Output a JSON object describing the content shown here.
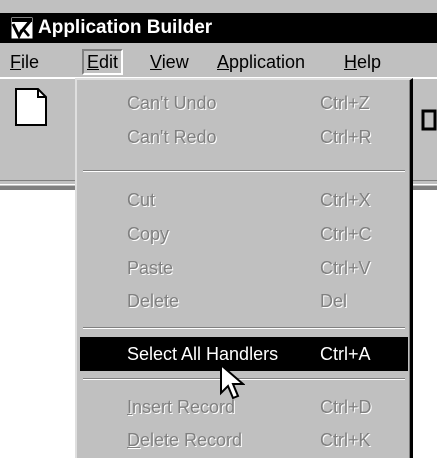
{
  "window": {
    "title": "Application Builder",
    "icon": "app-builder-icon"
  },
  "menubar": {
    "items": [
      {
        "label": "File",
        "accel": "F",
        "rest": "ile"
      },
      {
        "label": "Edit",
        "accel": "E",
        "rest": "dit"
      },
      {
        "label": "View",
        "accel": "V",
        "rest": "iew"
      },
      {
        "label": "Application",
        "accel": "A",
        "rest": "pplication"
      },
      {
        "label": "Help",
        "accel": "H",
        "rest": "elp"
      }
    ],
    "open_menu": "Edit"
  },
  "toolbar": {
    "new_icon": "new-document-icon"
  },
  "edit_menu": {
    "items": [
      {
        "label": "Can't Undo",
        "shortcut": "Ctrl+Z",
        "enabled": false
      },
      {
        "label": "Can't Redo",
        "shortcut": "Ctrl+R",
        "enabled": false
      },
      {
        "label": "Cut",
        "shortcut": "Ctrl+X",
        "enabled": false
      },
      {
        "label": "Copy",
        "shortcut": "Ctrl+C",
        "enabled": false
      },
      {
        "label": "Paste",
        "shortcut": "Ctrl+V",
        "enabled": false
      },
      {
        "label": "Delete",
        "shortcut": "Del",
        "enabled": false
      },
      {
        "label": "Select All Handlers",
        "shortcut": "Ctrl+A",
        "enabled": true,
        "highlighted": true
      },
      {
        "label": "Insert Record",
        "accel": "I",
        "rest": "nsert Record",
        "shortcut": "Ctrl+D",
        "enabled": false
      },
      {
        "label": "Delete Record",
        "accel": "D",
        "rest": "elete Record",
        "shortcut": "Ctrl+K",
        "enabled": false
      }
    ]
  },
  "colors": {
    "face": "#c0c0c0",
    "titlebar": "#000000",
    "highlight": "#000000",
    "disabled_text": "#808080"
  },
  "cursor": "arrow-pointer-icon"
}
